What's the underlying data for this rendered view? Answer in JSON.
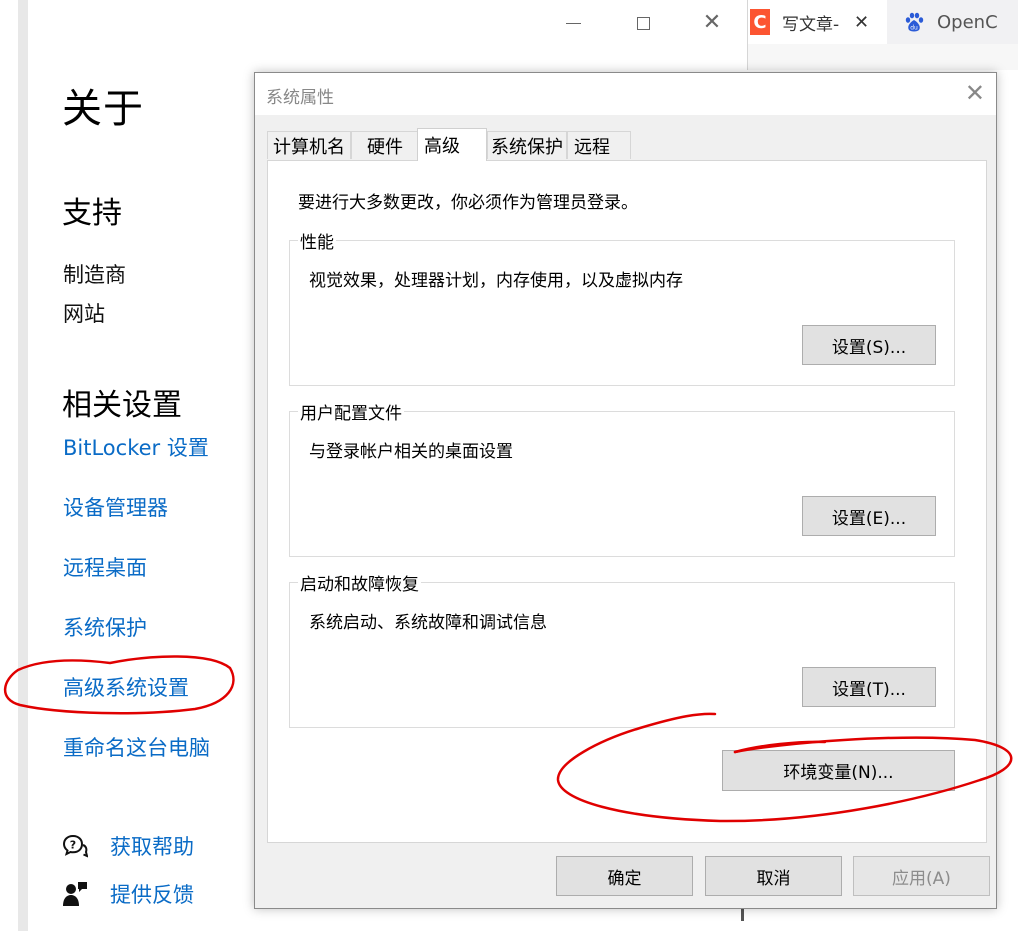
{
  "settings_window": {
    "heading": "关于",
    "support": {
      "title": "支持",
      "items": [
        "制造商",
        "网站"
      ]
    },
    "related": {
      "title": "相关设置",
      "links": [
        "BitLocker 设置",
        "设备管理器",
        "远程桌面",
        "系统保护",
        "高级系统设置",
        "重命名这台电脑"
      ]
    },
    "help": {
      "get_help": "获取帮助",
      "feedback": "提供反馈"
    }
  },
  "browser": {
    "tab1_favicon": "C",
    "tab1_title": "写文章-",
    "tab1_close": "✕",
    "tab2_title": "OpenC"
  },
  "dialog": {
    "title": "系统属性",
    "tabs": [
      {
        "label": "计算机名"
      },
      {
        "label": "硬件"
      },
      {
        "label": "高级"
      },
      {
        "label": "系统保护"
      },
      {
        "label": "远程"
      }
    ],
    "active_tab": "高级",
    "notice": "要进行大多数更改，你必须作为管理员登录。",
    "groups": {
      "performance": {
        "label": "性能",
        "desc": "视觉效果，处理器计划，内存使用，以及虚拟内存",
        "button": "设置(S)..."
      },
      "user_profiles": {
        "label": "用户配置文件",
        "desc": "与登录帐户相关的桌面设置",
        "button": "设置(E)..."
      },
      "startup_recovery": {
        "label": "启动和故障恢复",
        "desc": "系统启动、系统故障和调试信息",
        "button": "设置(T)..."
      }
    },
    "env_button": "环境变量(N)...",
    "ok": "确定",
    "cancel": "取消",
    "apply": "应用(A)"
  },
  "colors": {
    "link": "#0a6bc6",
    "annotation": "#e00000",
    "dialog_bg": "#f0f0f0",
    "csdn_brand": "#fc5531"
  }
}
